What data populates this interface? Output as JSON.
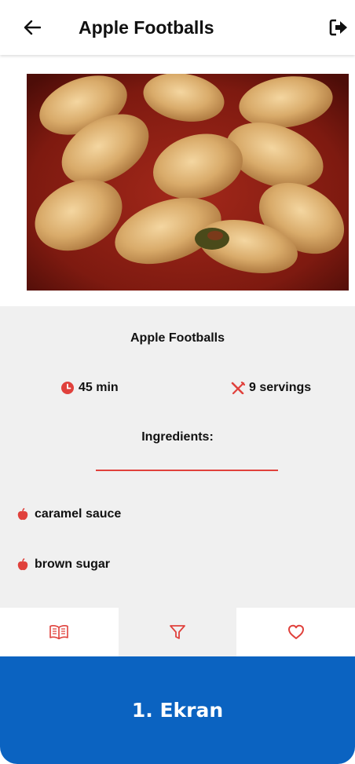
{
  "appbar": {
    "title": "Apple Footballs",
    "back_icon": "arrow-left-icon",
    "logout_icon": "sign-out-icon"
  },
  "recipe": {
    "image_icon": "recipe-photo",
    "title": "Apple Footballs",
    "time": "45 min",
    "time_icon": "clock-icon",
    "servings": "9 servings",
    "servings_icon": "utensils-icon",
    "ingredients_heading": "Ingredients:",
    "ingredients": [
      {
        "name": "caramel sauce",
        "icon": "apple-icon"
      },
      {
        "name": "brown sugar",
        "icon": "apple-icon"
      }
    ]
  },
  "bottom_nav": {
    "items": [
      {
        "icon": "book-icon",
        "active": false
      },
      {
        "icon": "filter-icon",
        "active": true
      },
      {
        "icon": "heart-icon",
        "active": false
      }
    ]
  },
  "caption": "1. Ekran",
  "colors": {
    "accent_red": "#e0413c",
    "caption_blue": "#0b63c1",
    "info_bg": "#f0f0f0"
  }
}
